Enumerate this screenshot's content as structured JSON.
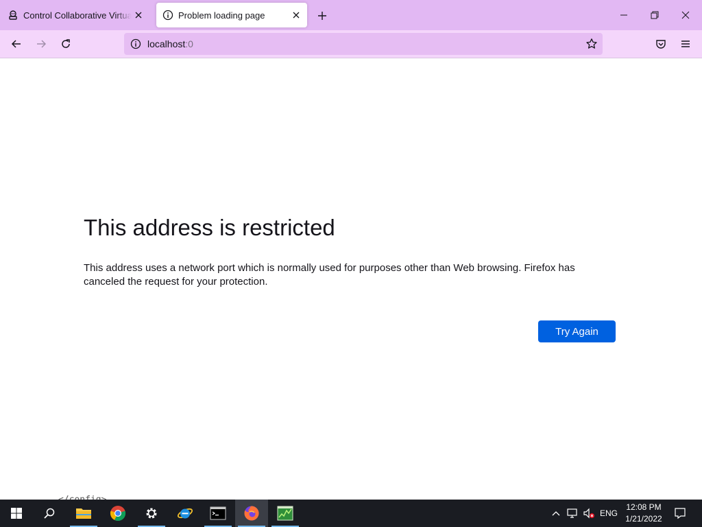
{
  "browser": {
    "tabs": [
      {
        "title": "Control Collaborative Virtual Machine",
        "icon": "vm-icon",
        "active": false
      },
      {
        "title": "Problem loading page",
        "icon": "info-icon",
        "active": true
      }
    ],
    "url": {
      "host": "localhost",
      "port": ":0"
    },
    "accent_color": "#e2b8f3"
  },
  "page": {
    "title": "This address is restricted",
    "description": "This address uses a network port which is normally used for purposes other than Web browsing. Firefox has canceled the request for your protection.",
    "try_again_label": "Try Again",
    "stray_text": "</config>",
    "button_color": "#0061e0"
  },
  "taskbar": {
    "apps": [
      "start-icon",
      "search-icon",
      "file-explorer-icon",
      "chrome-icon",
      "settings-icon",
      "internet-explorer-icon",
      "terminal-icon",
      "firefox-icon",
      "task-manager-icon"
    ],
    "language": "ENG",
    "time": "12:08 PM",
    "date": "1/21/2022"
  }
}
